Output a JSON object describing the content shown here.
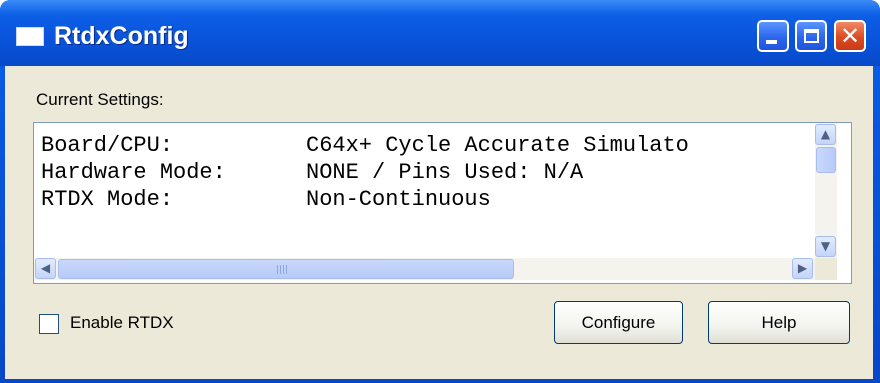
{
  "window": {
    "title": "RtdxConfig"
  },
  "titlebar_buttons": {
    "minimize": "minimize",
    "maximize": "maximize",
    "close": "close"
  },
  "settings": {
    "label": "Current Settings:",
    "rows": [
      {
        "key": "Board/CPU:",
        "value": "C64x+ Cycle Accurate Simulato"
      },
      {
        "key": "Hardware Mode:",
        "value": "NONE / Pins Used: N/A"
      },
      {
        "key": "RTDX Mode:",
        "value": "Non-Continuous"
      }
    ]
  },
  "enable_rtdx": {
    "label": "Enable RTDX",
    "checked": false
  },
  "buttons": {
    "configure": "Configure",
    "help": "Help"
  },
  "colors": {
    "titlebar": "#0a55dc",
    "client": "#ece9d8",
    "close_button": "#dd4a22"
  }
}
